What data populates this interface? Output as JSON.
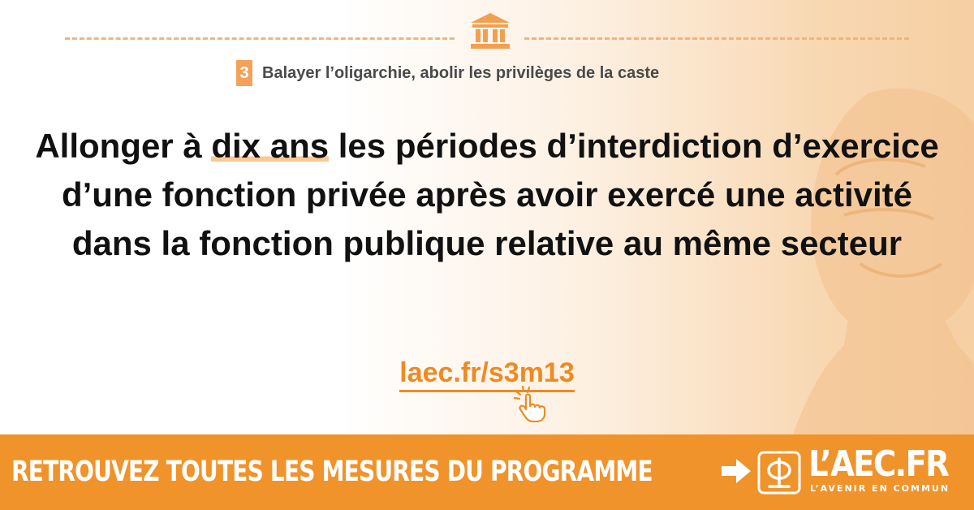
{
  "header": {
    "icon": "classical-building-icon",
    "section_number": "3",
    "section_title": "Balayer l’oligarchie, abolir les privilèges de la caste"
  },
  "headline": {
    "before": "Allonger à ",
    "highlight": "dix ans",
    "after": " les périodes d’interdiction d’exercice d’une fonction privée après avoir exercé une activité dans la fonction publique relative au même secteur"
  },
  "link": {
    "text": "laec.fr/s3m13",
    "icon": "pointing-hand-click-icon"
  },
  "banner": {
    "text": "RETROUVEZ TOUTES LES MESURES DU PROGRAMME",
    "arrow_icon": "right-arrow-icon",
    "logo_name": "L’AEC.FR",
    "logo_tagline": "L’AVENIR EN COMMUN"
  },
  "colors": {
    "accent": "#f0932a",
    "link": "#ef8a22",
    "highlight": "#f9c994",
    "text": "#111111"
  }
}
